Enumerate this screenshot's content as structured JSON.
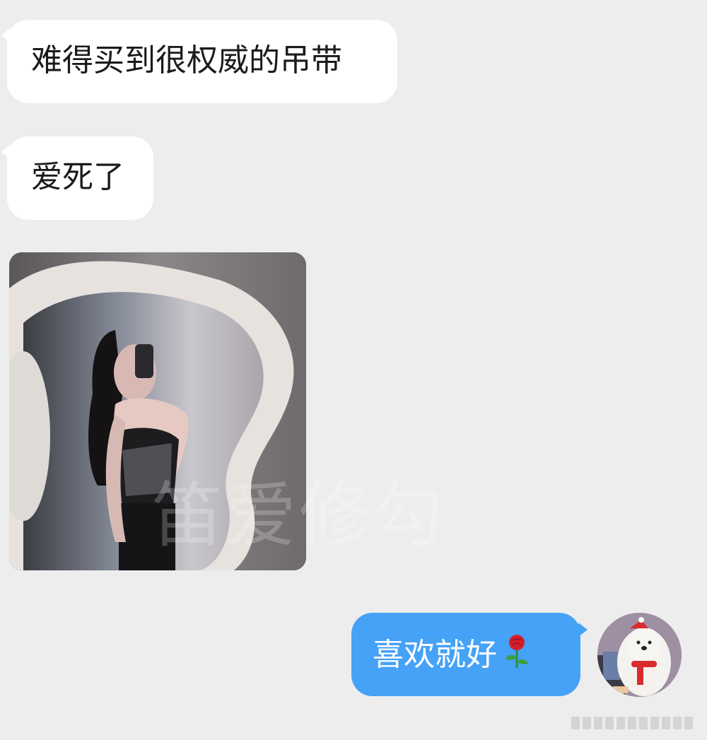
{
  "messages": {
    "incoming_1": "难得买到很权威的吊带",
    "incoming_2": "爱死了",
    "outgoing_1": "喜欢就好"
  },
  "photo": {
    "watermark_text": "笛爱修勾",
    "icon": "photo-thumbnail"
  },
  "outgoing_emoji": "rose-icon",
  "avatar": {
    "icon": "cartoon-polar-bear-avatar"
  },
  "colors": {
    "background": "#ededed",
    "incoming_bubble": "#ffffff",
    "outgoing_bubble": "#45a2f7",
    "outgoing_text": "#ffffff"
  }
}
